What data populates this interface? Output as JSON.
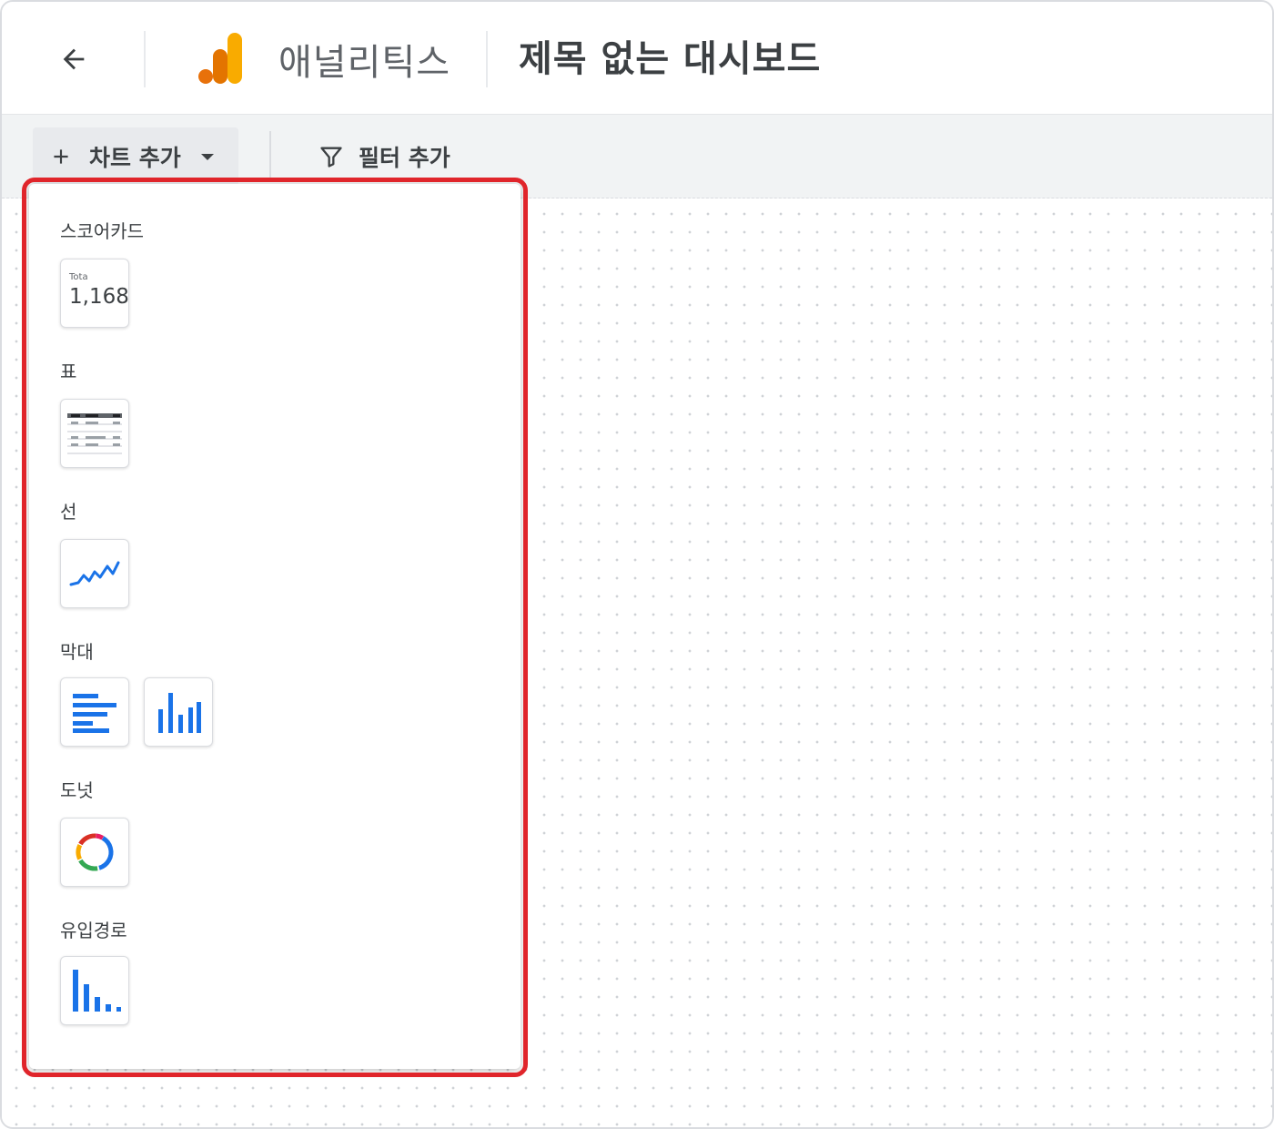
{
  "header": {
    "app_name": "애널리틱스",
    "dashboard_title": "제목 없는 대시보드",
    "logo_colors": [
      "#f9ab00",
      "#e37400",
      "#e8710a"
    ]
  },
  "toolbar": {
    "add_chart_label": "차트 추가",
    "add_filter_label": "필터 추가"
  },
  "menu": {
    "scorecard": {
      "label": "스코어카드",
      "sample_label": "Tota",
      "sample_value": "1,168"
    },
    "table": {
      "label": "표"
    },
    "line": {
      "label": "선"
    },
    "bar": {
      "label": "막대"
    },
    "donut": {
      "label": "도넛"
    },
    "funnel": {
      "label": "유입경로"
    }
  },
  "colors": {
    "accent_blue": "#1a73e8",
    "highlight_red": "#e0252b",
    "donut_segments": [
      "#1a73e8",
      "#d93025",
      "#f9ab00",
      "#34a853",
      "#e91e63"
    ]
  },
  "icons": [
    "back-arrow-icon",
    "analytics-logo-icon",
    "plus-icon",
    "caret-down-icon",
    "filter-icon"
  ]
}
